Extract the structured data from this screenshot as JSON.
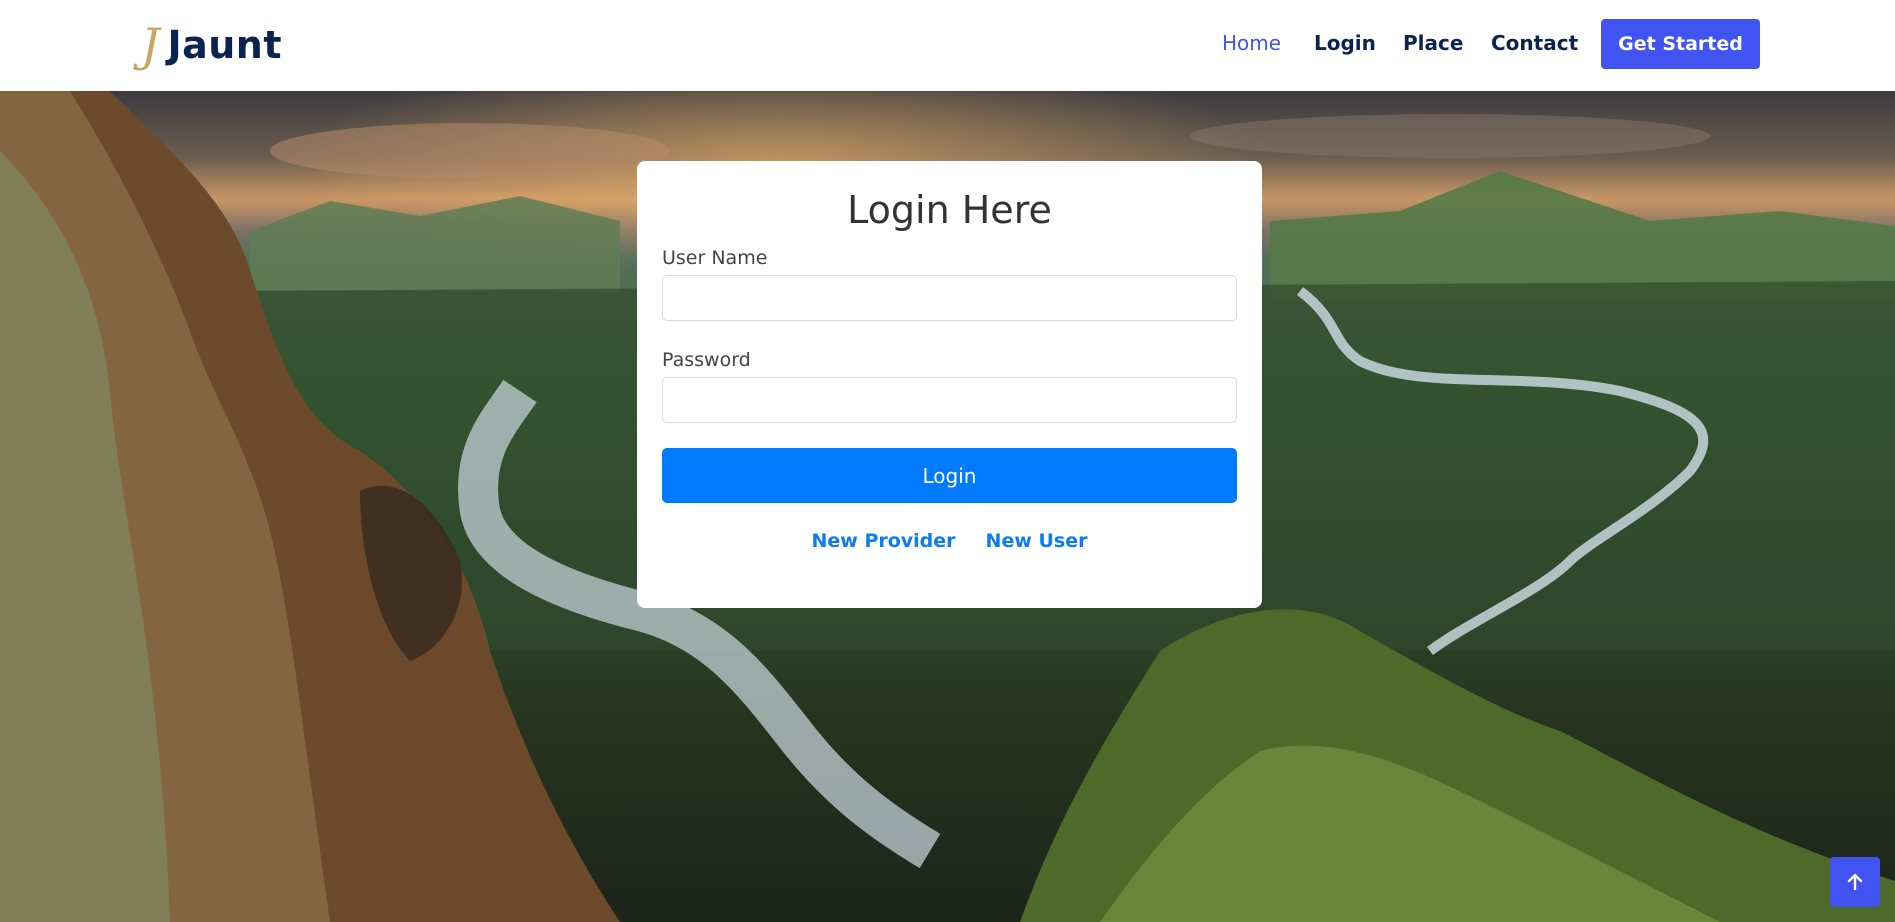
{
  "brand": {
    "logo_mark": "J",
    "name": "Jaunt"
  },
  "nav": {
    "items": [
      {
        "label": "Home",
        "active": true
      },
      {
        "label": "Login",
        "active": false
      },
      {
        "label": "Place",
        "active": false
      },
      {
        "label": "Contact",
        "active": false
      }
    ],
    "cta_label": "Get Started"
  },
  "login_form": {
    "title": "Login Here",
    "username_label": "User Name",
    "username_value": "",
    "password_label": "Password",
    "password_value": "",
    "submit_label": "Login",
    "links": [
      "New Provider",
      "New User"
    ]
  },
  "icons": {
    "scroll_top": "arrow-up-icon"
  },
  "colors": {
    "accent": "#4154f1",
    "brand_text": "#0b2350",
    "logo_gold": "#c9a560",
    "login_button": "#007bff",
    "link_blue": "#0d7cf0"
  }
}
